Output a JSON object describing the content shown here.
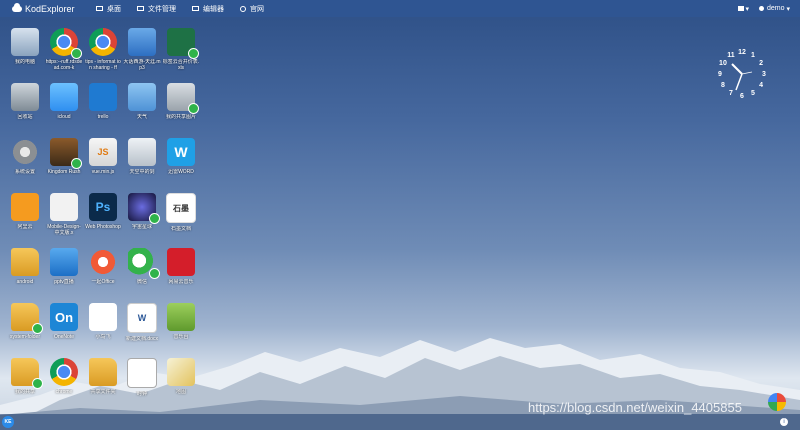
{
  "topbar": {
    "brand": "KodExplorer",
    "nav": [
      "桌面",
      "文件管理",
      "编辑器",
      "官网"
    ],
    "user": "demo"
  },
  "desktop": {
    "icons": [
      {
        "label": "我的电脑",
        "kind": "pc",
        "share": false
      },
      {
        "label": "https:--ruff.rdsdead.com-k",
        "kind": "chrome",
        "share": true
      },
      {
        "label": "tips - informat ion sharing - ff",
        "kind": "chrome",
        "share": false
      },
      {
        "label": "大话西游-天涯.mp3",
        "kind": "music",
        "share": false
      },
      {
        "label": "标签云合并价表.xls",
        "kind": "excel",
        "share": true
      },
      {
        "label": "回收站",
        "kind": "trash",
        "share": false
      },
      {
        "label": "icloud",
        "kind": "icloud",
        "share": false
      },
      {
        "label": "trello",
        "kind": "trello",
        "share": false
      },
      {
        "label": "天气",
        "kind": "weather",
        "share": false
      },
      {
        "label": "我的共享图片",
        "kind": "gray",
        "share": true
      },
      {
        "label": "系统设置",
        "kind": "gear",
        "share": false
      },
      {
        "label": "Kingdom Rush",
        "kind": "kingdom",
        "share": true
      },
      {
        "label": "vue.min.js",
        "kind": "js",
        "share": false
      },
      {
        "label": "天空中的剑",
        "kind": "rocket",
        "share": false
      },
      {
        "label": "迅雷WORD",
        "kind": "w",
        "share": false
      },
      {
        "label": "阿里云",
        "kind": "ali",
        "share": false
      },
      {
        "label": "Mobile-Design-中文版.x",
        "kind": "doc",
        "share": false
      },
      {
        "label": "Web Photoshop",
        "kind": "ps",
        "share": false
      },
      {
        "label": "宇宙星球",
        "kind": "space",
        "share": true
      },
      {
        "label": "石墨文档",
        "kind": "shi",
        "share": false
      },
      {
        "label": "android",
        "kind": "folder",
        "share": false
      },
      {
        "label": "pptv直播",
        "kind": "player",
        "share": false
      },
      {
        "label": "一起Office",
        "kind": "cross",
        "share": false
      },
      {
        "label": "微信",
        "kind": "wechat",
        "share": true
      },
      {
        "label": "网易云音乐",
        "kind": "netease",
        "share": false
      },
      {
        "label": "system-folder",
        "kind": "folder",
        "share": true
      },
      {
        "label": "OneNote",
        "kind": "on",
        "share": false
      },
      {
        "label": "小鸟飞",
        "kind": "bird",
        "share": false
      },
      {
        "label": "新建文档.docx",
        "kind": "word",
        "share": false
      },
      {
        "label": "音乐台",
        "kind": "green",
        "share": false
      },
      {
        "label": "我的共享",
        "kind": "folder",
        "share": true
      },
      {
        "label": "chrome",
        "kind": "chrome",
        "share": false
      },
      {
        "label": "共享文件夹",
        "kind": "folder",
        "share": false
      },
      {
        "label": "时钟",
        "kind": "clock",
        "share": false
      },
      {
        "label": "地图",
        "kind": "map",
        "share": false
      }
    ]
  },
  "clock": {
    "numbers": [
      "12",
      "1",
      "2",
      "3",
      "4",
      "5",
      "6",
      "7",
      "8",
      "9",
      "10",
      "11"
    ]
  },
  "taskbar": {
    "start_label": "KE",
    "info": "i"
  },
  "watermark": "https://blog.csdn.net/weixin_4405855"
}
